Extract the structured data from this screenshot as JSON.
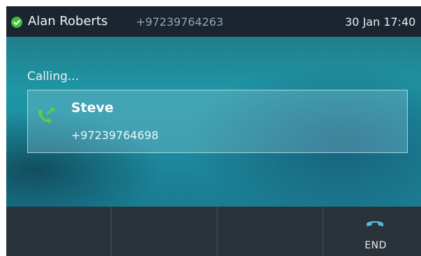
{
  "status_bar": {
    "registration_icon": "check-circle-icon",
    "user_name": "Alan Roberts",
    "user_number": "+97239764263",
    "datetime": "30 Jan 17:40"
  },
  "call": {
    "state_label": "Calling...",
    "direction_icon": "outgoing-call-icon",
    "contact_name": "Steve",
    "contact_number": "+97239764698"
  },
  "softkeys": [
    {
      "label": ""
    },
    {
      "label": ""
    },
    {
      "label": ""
    },
    {
      "label": "END",
      "icon": "end-call-icon"
    }
  ],
  "colors": {
    "accent_green": "#3fbf3a",
    "end_icon": "#55b8d8"
  }
}
